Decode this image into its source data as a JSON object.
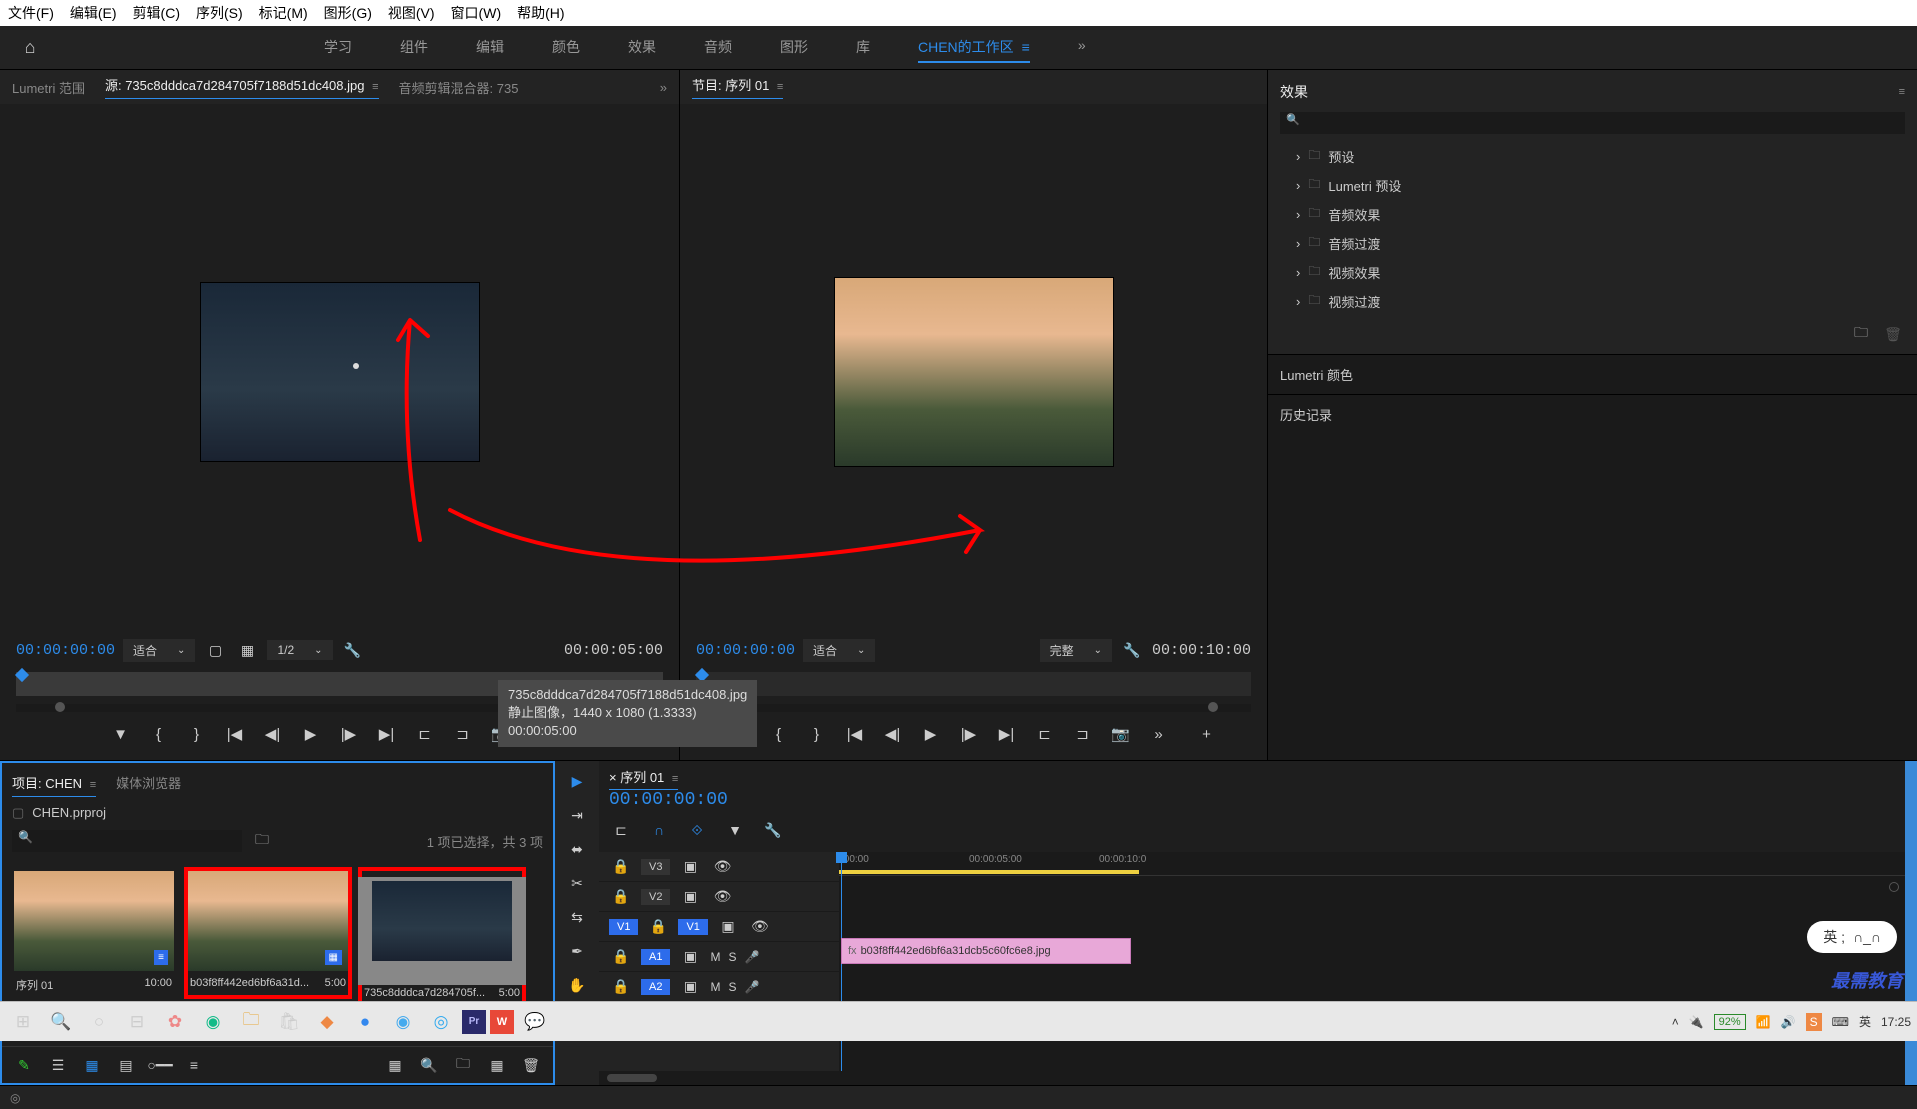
{
  "menuBar": {
    "items": [
      "文件(F)",
      "编辑(E)",
      "剪辑(C)",
      "序列(S)",
      "标记(M)",
      "图形(G)",
      "视图(V)",
      "窗口(W)",
      "帮助(H)"
    ]
  },
  "workspaces": {
    "items": [
      "学习",
      "组件",
      "编辑",
      "颜色",
      "效果",
      "音频",
      "图形",
      "库"
    ],
    "active": "CHEN的工作区"
  },
  "sourcePanel": {
    "tabs": {
      "lumetri": "Lumetri 范围",
      "source": "源: 735c8dddca7d284705f7188d51dc408.jpg",
      "audioMixer": "音频剪辑混合器: 735"
    },
    "tcIn": "00:00:00:00",
    "tcOut": "00:00:05:00",
    "fit": "适合",
    "res": "1/2"
  },
  "programPanel": {
    "tab": "节目: 序列 01",
    "tcIn": "00:00:00:00",
    "tcOut": "00:00:10:00",
    "fit": "适合",
    "res": "完整"
  },
  "effects": {
    "title": "效果",
    "items": [
      "预设",
      "Lumetri 预设",
      "音频效果",
      "音频过渡",
      "视频效果",
      "视频过渡"
    ]
  },
  "sidePanels": {
    "lumetriColor": "Lumetri 颜色",
    "history": "历史记录"
  },
  "project": {
    "tabs": {
      "project": "项目: CHEN",
      "mediaBrowser": "媒体浏览器"
    },
    "file": "CHEN.prproj",
    "selection": "1 项已选择，共 3 项",
    "bins": [
      {
        "name": "序列 01",
        "dur": "10:00",
        "type": "sequence"
      },
      {
        "name": "b03f8ff442ed6bf6a31d...",
        "dur": "5:00",
        "type": "clip"
      },
      {
        "name": "735c8dddca7d284705f...",
        "dur": "5:00",
        "type": "clip"
      }
    ]
  },
  "tooltip": {
    "line1": "735c8dddca7d284705f7188d51dc408.jpg",
    "line2": "静止图像，1440 x 1080 (1.3333)",
    "line3": "00:00:05:00"
  },
  "timeline": {
    "tab": "序列 01",
    "tc": "00:00:00:00",
    "rulerTicks": [
      ":00:00",
      "00:00:05:00",
      "00:00:10:0"
    ],
    "videoTracks": [
      "V3",
      "V2",
      "V1"
    ],
    "audioTracks": [
      "A1",
      "A2"
    ],
    "clip": "b03f8ff442ed6bf6a31dcb5c60fc6e8.jpg"
  },
  "taskbar": {
    "battery": "92%",
    "ime": "英",
    "time": "17:25"
  },
  "watermark": "最需教育",
  "imeBubble": "英 ;"
}
